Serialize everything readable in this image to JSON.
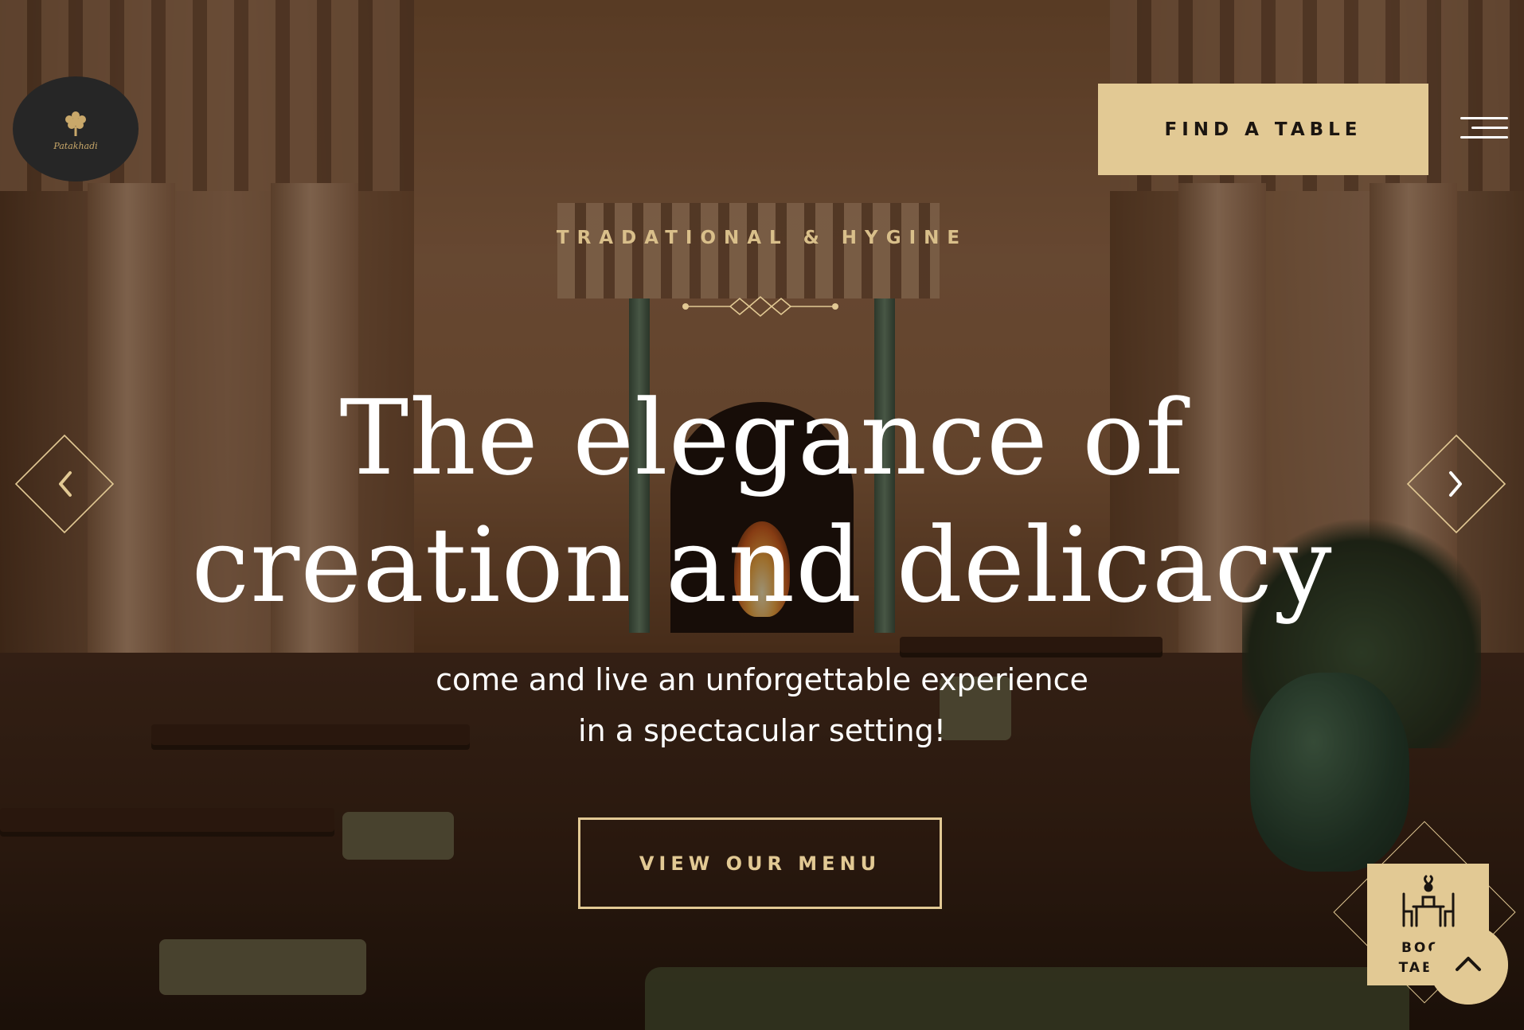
{
  "header": {
    "logo_text": "Patakhadi",
    "find_table_label": "FIND A TABLE"
  },
  "hero": {
    "eyebrow": "TRADATIONAL & HYGINE",
    "headline_line1": "The elegance of",
    "headline_line2": "creation and delicacy",
    "subtitle_line1": "come and live an unforgettable experience",
    "subtitle_line2": "in a spectacular setting!",
    "cta_label": "VIEW OUR MENU"
  },
  "slider": {
    "prev_icon": "chevron-left-icon",
    "next_icon": "chevron-right-icon"
  },
  "book_widget": {
    "line1": "BOOK",
    "line2": "TABLE",
    "icon": "dining-table-icon"
  },
  "scroll_top_icon": "chevron-up-icon",
  "colors": {
    "accent": "#e2c994",
    "eyebrow": "#d9bf8a",
    "logo_bg": "#262626",
    "text_light": "#ffffff",
    "text_dark": "#1b1510"
  }
}
